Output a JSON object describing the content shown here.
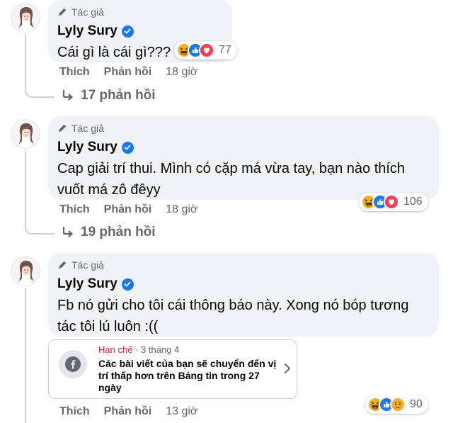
{
  "comments": [
    {
      "badge": "Tác giả",
      "author": "Lyly Sury",
      "text": "Cái gì là cái gì???",
      "reactions": [
        "haha",
        "like",
        "love"
      ],
      "reaction_count": "77",
      "like_label": "Thích",
      "reply_label": "Phản hồi",
      "time": "18 giờ",
      "replies_label": "17 phản hồi"
    },
    {
      "badge": "Tác giả",
      "author": "Lyly Sury",
      "text": "Cap giải trí thui. Mình có cặp má vừa tay, bạn nào thích vuốt má zô đêyy",
      "reactions": [
        "haha",
        "like",
        "love"
      ],
      "reaction_count": "106",
      "like_label": "Thích",
      "reply_label": "Phản hồi",
      "time": "18 giờ",
      "replies_label": "19 phản hồi"
    },
    {
      "badge": "Tác giả",
      "author": "Lyly Sury",
      "text": "Fb nó gửi cho tôi cái thông báo này. Xong nó bóp tương tác tôi lú luôn :((",
      "reactions": [
        "haha",
        "like",
        "sad"
      ],
      "reaction_count": "90",
      "like_label": "Thích",
      "reply_label": "Phản hồi",
      "time": "13 giờ"
    }
  ],
  "notice": {
    "status": "Hạn chế",
    "date": "3 tháng 4",
    "text": "Các bài viết của bạn sẽ chuyển đến vị trí thấp hơn trên Bảng tin trong 27 ngày"
  },
  "colors": {
    "verified": "#1877f2",
    "bubble": "#f0f2f5",
    "muted_text": "#65676b",
    "limit_red": "#e41e3f",
    "thread_line": "#ced0d4"
  }
}
